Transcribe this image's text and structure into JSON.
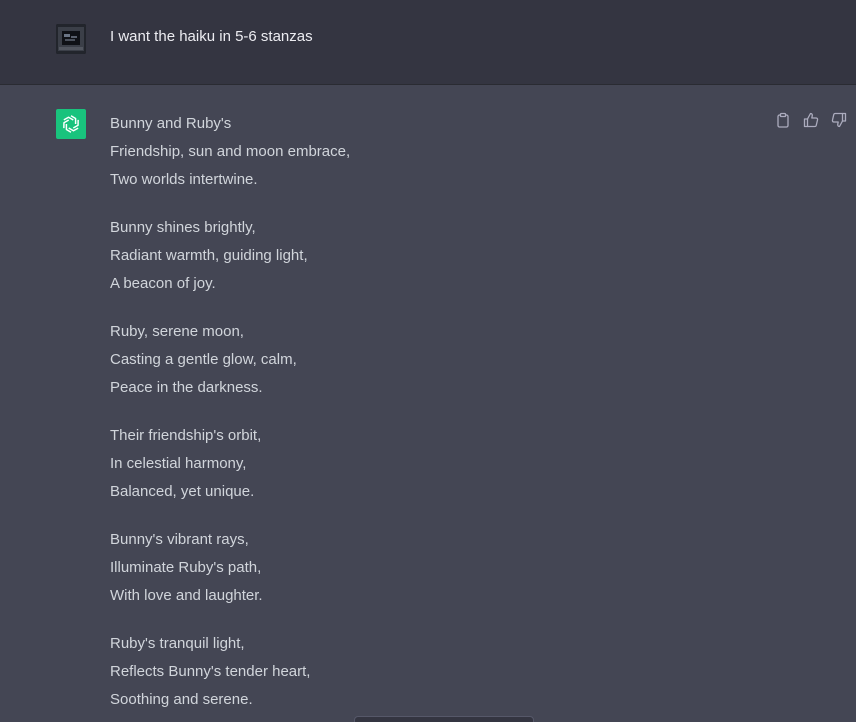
{
  "user_message": {
    "text": "I want the haiku in 5-6 stanzas"
  },
  "assistant_message": {
    "stanzas": [
      {
        "lines": [
          "Bunny and Ruby's",
          "Friendship, sun and moon embrace,",
          "Two worlds intertwine."
        ]
      },
      {
        "lines": [
          "Bunny shines brightly,",
          "Radiant warmth, guiding light,",
          "A beacon of joy."
        ]
      },
      {
        "lines": [
          "Ruby, serene moon,",
          "Casting a gentle glow, calm,",
          "Peace in the darkness."
        ]
      },
      {
        "lines": [
          "Their friendship's orbit,",
          "In celestial harmony,",
          "Balanced, yet unique."
        ]
      },
      {
        "lines": [
          "Bunny's vibrant rays,",
          "Illuminate Ruby's path,",
          "With love and laughter."
        ]
      },
      {
        "lines": [
          "Ruby's tranquil light,",
          "Reflects Bunny's tender heart,",
          "Soothing and serene."
        ]
      }
    ],
    "actions": [
      {
        "name": "copy-icon"
      },
      {
        "name": "thumbs-up-icon"
      },
      {
        "name": "thumbs-down-icon"
      }
    ]
  },
  "colors": {
    "user_bg": "#343541",
    "assistant_bg": "#444654",
    "bot_avatar_bg": "#19c37d",
    "text": "#d1d5db"
  }
}
